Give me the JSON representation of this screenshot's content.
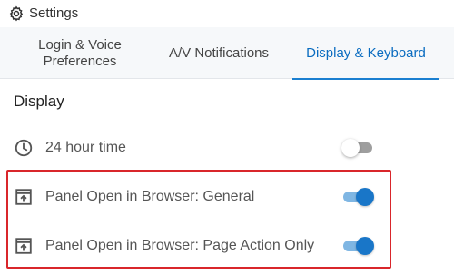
{
  "window": {
    "title": "Settings"
  },
  "tabs": [
    {
      "label": "Login & Voice Preferences",
      "active": false
    },
    {
      "label": "A/V Notifications",
      "active": false
    },
    {
      "label": "Display & Keyboard",
      "active": true
    }
  ],
  "section": {
    "title": "Display"
  },
  "settings": [
    {
      "label": "24 hour time",
      "icon": "clock-icon",
      "enabled": false
    },
    {
      "label": "Panel Open in Browser: General",
      "icon": "open-in-browser-icon",
      "enabled": true
    },
    {
      "label": "Panel Open in Browser: Page Action Only",
      "icon": "open-in-browser-icon",
      "enabled": true
    }
  ],
  "colors": {
    "accent": "#1976c8",
    "highlight_border": "#d9262b"
  }
}
